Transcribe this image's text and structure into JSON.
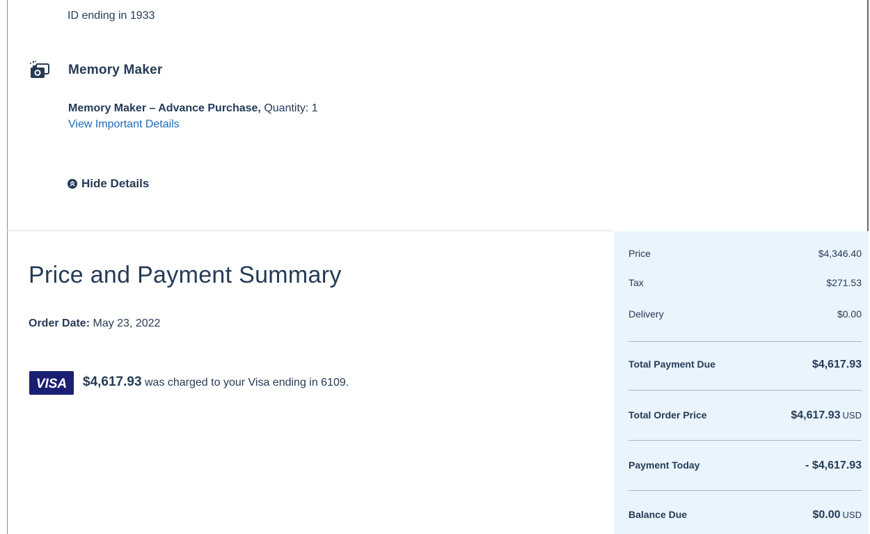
{
  "upper": {
    "id_line": "ID ending in 1933",
    "section_title": "Memory Maker",
    "product_name": "Memory Maker – Advance Purchase,",
    "quantity_text": "Quantity: 1",
    "details_link": "View Important Details",
    "hide_details": "Hide Details"
  },
  "summary": {
    "title": "Price and Payment Summary",
    "order_date_label": "Order Date:",
    "order_date_value": "May 23, 2022",
    "visa_label": "VISA",
    "charge_amount": "$4,617.93",
    "charge_text": "was charged to your Visa ending in 6109."
  },
  "panel": {
    "price_label": "Price",
    "price_value": "$4,346.40",
    "tax_label": "Tax",
    "tax_value": "$271.53",
    "delivery_label": "Delivery",
    "delivery_value": "$0.00",
    "total_due_label": "Total Payment Due",
    "total_due_value": "$4,617.93",
    "order_price_label": "Total Order Price",
    "order_price_value": "$4,617.93",
    "order_price_unit": "USD",
    "payment_today_label": "Payment Today",
    "payment_today_value": "- $4,617.93",
    "balance_label": "Balance Due",
    "balance_value": "$0.00",
    "balance_unit": "USD"
  },
  "colors": {
    "text": "#253b56",
    "link": "#1e6ab8",
    "panel_bg": "#e9f4fd",
    "visa_bg": "#1a1f71"
  }
}
